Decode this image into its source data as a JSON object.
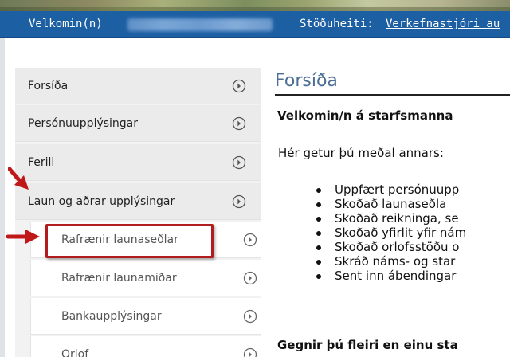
{
  "header": {
    "welcome_label": "Velkomin(n)",
    "position_label": "Stöðuheiti:",
    "position_value": "Verkefnastjóri au"
  },
  "sidebar": {
    "items": [
      {
        "label": "Forsíða"
      },
      {
        "label": "Persónuupplýsingar"
      },
      {
        "label": "Ferill"
      },
      {
        "label": "Laun og aðrar upplýsingar"
      }
    ],
    "subitems": [
      {
        "label": "Rafrænir launaseðlar"
      },
      {
        "label": "Rafrænir launamiðar"
      },
      {
        "label": "Bankaupplýsingar"
      },
      {
        "label": "Orlof"
      }
    ]
  },
  "main": {
    "title": "Forsíða",
    "welcome_heading": "Velkomin/n á starfsmanna",
    "intro": "Hér getur þú meðal annars:",
    "features": [
      "Uppfært persónuupp",
      "Skoðað launaseðla",
      "Skoðað reikninga, se",
      "Skoðað yfirlit yfir nám",
      "Skoðað orlofsstöðu o",
      "Skráð náms- og star",
      "Sent inn ábendingar"
    ],
    "multi_role_heading": "Gegnir þú fleiri en einu sta"
  },
  "colors": {
    "header_blue": "#1d5fa3",
    "title_blue": "#4a6e95",
    "annotation_red": "#b11c1c"
  }
}
